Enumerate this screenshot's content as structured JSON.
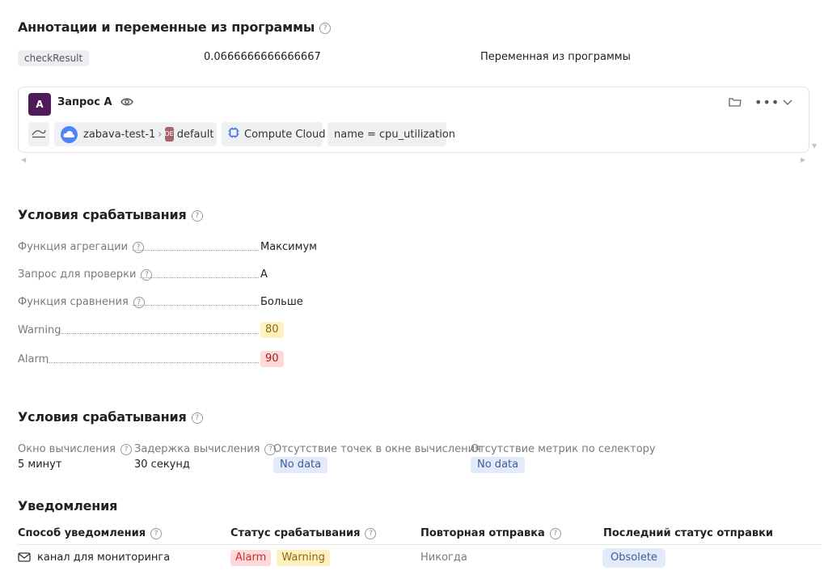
{
  "annotations": {
    "title": "Аннотации и переменные из программы",
    "items": [
      {
        "name": "checkResult",
        "value": "0.0666666666666667",
        "type": "Переменная из программы"
      }
    ]
  },
  "query": {
    "avatar": "A",
    "title": "Запрос A",
    "cloud": "zabava-test-1",
    "folder_badge": "DE",
    "folder": "default",
    "service": "Compute Cloud",
    "selector": "name = cpu_utilization"
  },
  "conditions": {
    "title": "Условия срабатывания",
    "rows": [
      {
        "label": "Функция агрегации",
        "value": "Максимум"
      },
      {
        "label": "Запрос для проверки",
        "value": "A"
      },
      {
        "label": "Функция сравнения",
        "value": "Больше"
      },
      {
        "label": "Warning",
        "value": "80"
      },
      {
        "label": "Alarm",
        "value": "90"
      }
    ]
  },
  "evaluation": {
    "title": "Условия срабатывания",
    "window_label": "Окно вычисления",
    "window_value": "5 минут",
    "delay_label": "Задержка вычисления",
    "delay_value": "30 секунд",
    "no_points_label": "Отсутствие точек в окне вычисления",
    "no_points_value": "No data",
    "no_metrics_label": "Отсутствие метрик по селектору",
    "no_metrics_value": "No data"
  },
  "notifications": {
    "title": "Уведомления",
    "headers": [
      "Способ уведомления",
      "Статус срабатывания",
      "Повторная отправка",
      "Последний статус отправки"
    ],
    "rows": [
      {
        "channel": "канал для мониторинга",
        "statuses": [
          "Alarm",
          "Warning"
        ],
        "repeat": "Никогда",
        "last_status": "Obsolete"
      }
    ]
  },
  "colors": {
    "accent_avatar": "#4e1a5a",
    "warning_bg": "#fff0c0",
    "alarm_bg": "#ffd9d9",
    "nodata_bg": "#e3ebfb"
  },
  "icons": [
    "help-icon",
    "eye-icon",
    "folder-icon",
    "more-icon",
    "chevron-down-icon",
    "chart-icon",
    "cloud-icon",
    "chip-icon",
    "mail-icon"
  ]
}
